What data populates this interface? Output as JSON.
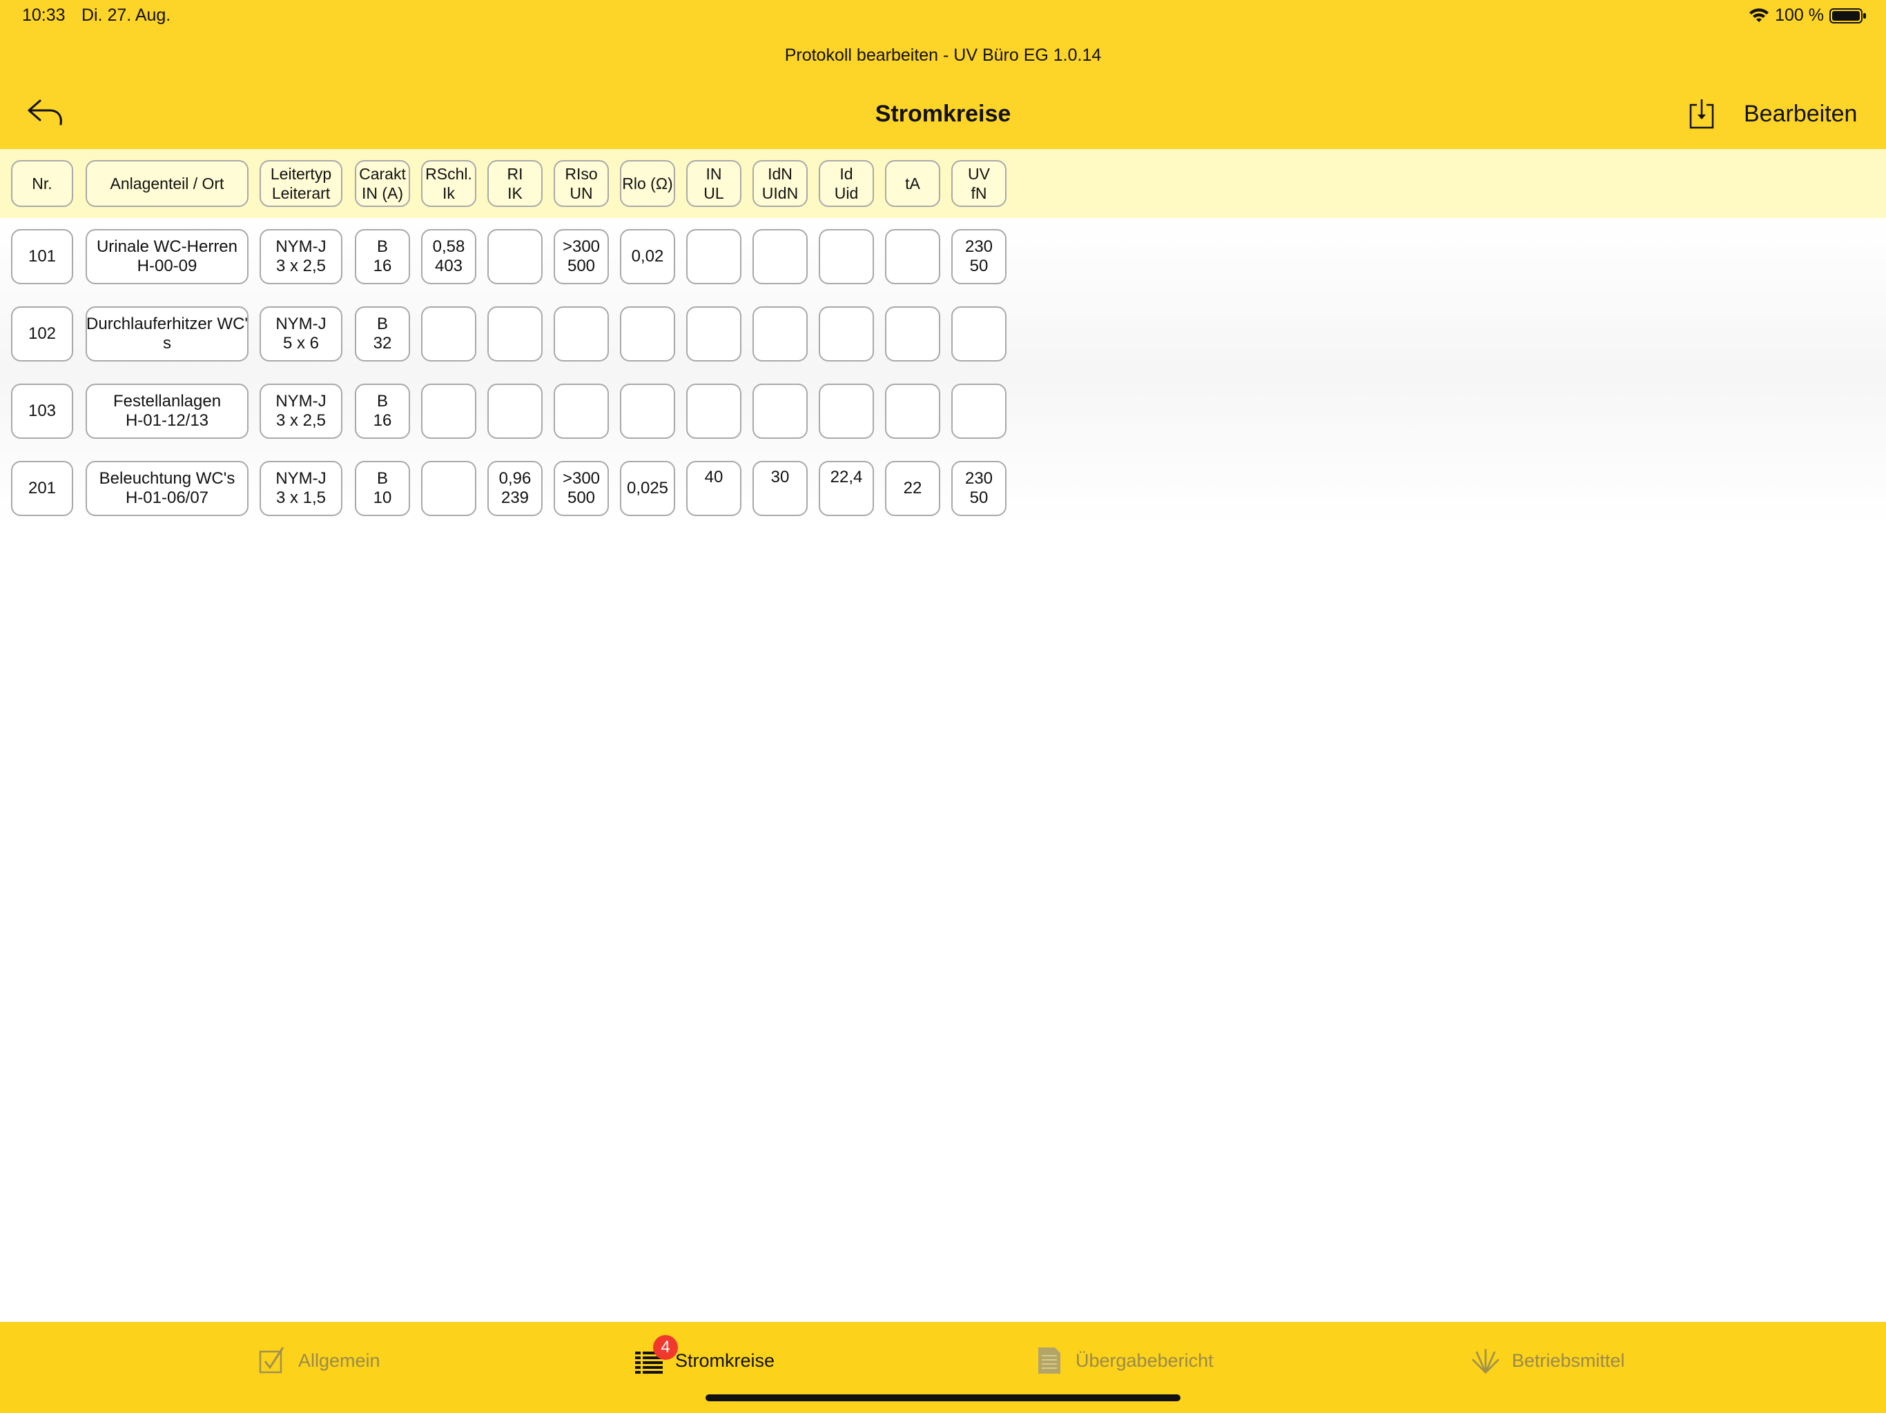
{
  "status": {
    "time": "10:33",
    "date": "Di. 27. Aug.",
    "battery": "100 %"
  },
  "window_title": "Protokoll bearbeiten - UV Büro EG 1.0.14",
  "nav": {
    "title": "Stromkreise",
    "edit_label": "Bearbeiten"
  },
  "table": {
    "headers": [
      [
        "Nr."
      ],
      [
        "Anlagenteil / Ort"
      ],
      [
        "Leitertyp",
        "Leiterart"
      ],
      [
        "Carakt",
        "IN (A)"
      ],
      [
        "RSchl.",
        "Ik"
      ],
      [
        "RI",
        "IK"
      ],
      [
        "RIso",
        "UN"
      ],
      [
        "Rlo (Ω)"
      ],
      [
        "IN",
        "UL"
      ],
      [
        "IdN",
        "UIdN"
      ],
      [
        "Id",
        "Uid"
      ],
      [
        "tA"
      ],
      [
        "UV",
        "fN"
      ]
    ],
    "rows": [
      [
        [
          "101"
        ],
        [
          "Urinale WC-Herren",
          "H-00-09"
        ],
        [
          "NYM-J",
          "3 x 2,5"
        ],
        [
          "B",
          "16"
        ],
        [
          "0,58",
          "403"
        ],
        [],
        [
          ">300",
          "500"
        ],
        [
          "0,02"
        ],
        [],
        [],
        [],
        [],
        [
          "230",
          "50"
        ]
      ],
      [
        [
          "102"
        ],
        [
          "Durchlauferhitzer WC'",
          "s"
        ],
        [
          "NYM-J",
          "5 x 6"
        ],
        [
          "B",
          "32"
        ],
        [],
        [],
        [],
        [],
        [],
        [],
        [],
        [],
        []
      ],
      [
        [
          "103"
        ],
        [
          "Festellanlagen",
          "H-01-12/13"
        ],
        [
          "NYM-J",
          "3 x 2,5"
        ],
        [
          "B",
          "16"
        ],
        [],
        [],
        [],
        [],
        [],
        [],
        [],
        [],
        []
      ],
      [
        [
          "201"
        ],
        [
          "Beleuchtung WC's",
          "H-01-06/07"
        ],
        [
          "NYM-J",
          "3 x 1,5"
        ],
        [
          "B",
          "10"
        ],
        [],
        [
          "0,96",
          "239"
        ],
        [
          ">300",
          "500"
        ],
        [
          "0,025"
        ],
        [
          "40"
        ],
        [
          "30"
        ],
        [
          "22,4"
        ],
        [
          "22"
        ],
        [
          "230",
          "50"
        ]
      ]
    ]
  },
  "tabs": [
    {
      "label": "Allgemein",
      "icon": "checkbox-icon",
      "active": false
    },
    {
      "label": "Stromkreise",
      "icon": "list-icon",
      "active": true,
      "badge": "4"
    },
    {
      "label": "Übergabebericht",
      "icon": "document-icon",
      "active": false
    },
    {
      "label": "Betriebsmittel",
      "icon": "tools-icon",
      "active": false
    }
  ]
}
